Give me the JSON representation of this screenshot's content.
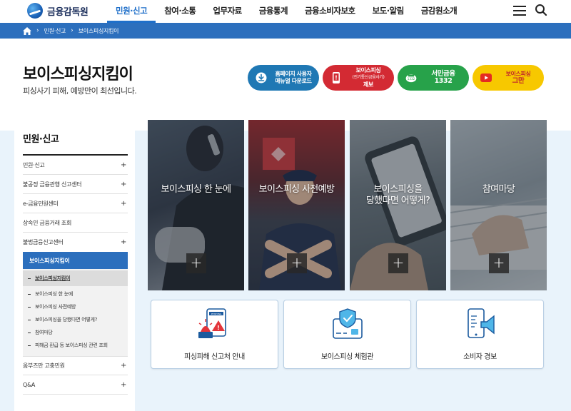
{
  "header": {
    "logo_text": "금융감독원",
    "nav": [
      "민원·신고",
      "참여·소통",
      "업무자료",
      "금융통계",
      "금융소비자보호",
      "보도·알림",
      "금감원소개"
    ],
    "active_nav": "민원·신고"
  },
  "breadcrumb": [
    "민원·신고",
    "보이스피싱지킴이"
  ],
  "page": {
    "title": "보이스피싱지킴이",
    "subtitle": "피싱사기 피해, 예방만이 최선입니다."
  },
  "quick_buttons": [
    {
      "line1": "홈페이지 사용자",
      "line2": "매뉴얼 다운로드",
      "color": "#1f78b4",
      "icon": "download-icon"
    },
    {
      "line1": "보이스피싱",
      "line2": "(전기통신금융사기)",
      "line3": "제보",
      "color": "#d32a33",
      "icon": "phone-alert-icon"
    },
    {
      "line1": "서민금융",
      "line2": "1332",
      "color": "#27a24a",
      "icon": "piggy-bank-icon"
    },
    {
      "line1": "보이스피싱",
      "line2": "그만",
      "color": "#f7c800",
      "icon": "youtube-icon"
    }
  ],
  "side_nav": {
    "title": "민원·신고",
    "items_top": [
      {
        "label": "민원·신고",
        "expand": "+"
      },
      {
        "label": "불공정 금융관행 신고센터",
        "expand": "+"
      },
      {
        "label": "e-금융민원센터",
        "expand": "+"
      },
      {
        "label": "상속인 금융거래 조회",
        "expand": ""
      },
      {
        "label": "불법금융신고센터",
        "expand": "+"
      }
    ],
    "active": "보이스피싱지킴이",
    "sub_items": [
      "보이스피싱지킴이",
      "보이스피싱 한 눈에",
      "보이스피싱 사전예방",
      "보이스피싱을 당했다면 어떻게?",
      "참여마당",
      "피해금 환급 등 보이스피싱 관련 조회"
    ],
    "items_bottom": [
      {
        "label": "옴부즈만 고충민원",
        "expand": "+"
      },
      {
        "label": "Q&A",
        "expand": "+"
      }
    ]
  },
  "tiles": [
    {
      "label": "보이스피싱 한 눈에",
      "plus": "+"
    },
    {
      "label": "보이스피싱 사전예방",
      "plus": "+"
    },
    {
      "label_line1": "보이스피싱을",
      "label_line2": "당했다면 어떻게?",
      "plus": "+"
    },
    {
      "label": "참여마당",
      "plus": "+"
    }
  ],
  "cards": [
    {
      "label": "피싱피해 신고처 안내",
      "icon": "phishing-alert-icon",
      "icon_text": "PHISHING"
    },
    {
      "label": "보이스피싱 체험관",
      "icon": "shield-card-icon"
    },
    {
      "label": "소비자 경보",
      "icon": "phone-megaphone-icon"
    }
  ]
}
